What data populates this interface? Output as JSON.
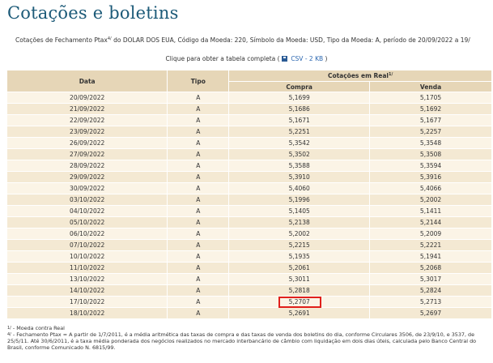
{
  "title": "Cotações e boletins",
  "description": {
    "prefix": "Cotações de Fechamento Ptax",
    "sup": "4/",
    "suffix": " do DOLAR DOS EUA, Código da Moeda: 220, Símbolo da Moeda: USD, Tipo da Moeda: A, período de 20/09/2022 a 19/"
  },
  "download": {
    "prefix": "Clique para obter a tabela completa ( ",
    "icon": "save-disk-icon",
    "link_label": "CSV - 2 KB",
    "suffix": " )"
  },
  "table": {
    "headers": {
      "data": "Data",
      "tipo": "Tipo",
      "cotacoes": "Cotações em Real",
      "cotacoes_sup": "1/",
      "compra": "Compra",
      "venda": "Venda"
    },
    "rows": [
      {
        "data": "20/09/2022",
        "tipo": "A",
        "compra": "5,1699",
        "venda": "5,1705"
      },
      {
        "data": "21/09/2022",
        "tipo": "A",
        "compra": "5,1686",
        "venda": "5,1692"
      },
      {
        "data": "22/09/2022",
        "tipo": "A",
        "compra": "5,1671",
        "venda": "5,1677"
      },
      {
        "data": "23/09/2022",
        "tipo": "A",
        "compra": "5,2251",
        "venda": "5,2257"
      },
      {
        "data": "26/09/2022",
        "tipo": "A",
        "compra": "5,3542",
        "venda": "5,3548"
      },
      {
        "data": "27/09/2022",
        "tipo": "A",
        "compra": "5,3502",
        "venda": "5,3508"
      },
      {
        "data": "28/09/2022",
        "tipo": "A",
        "compra": "5,3588",
        "venda": "5,3594"
      },
      {
        "data": "29/09/2022",
        "tipo": "A",
        "compra": "5,3910",
        "venda": "5,3916"
      },
      {
        "data": "30/09/2022",
        "tipo": "A",
        "compra": "5,4060",
        "venda": "5,4066"
      },
      {
        "data": "03/10/2022",
        "tipo": "A",
        "compra": "5,1996",
        "venda": "5,2002"
      },
      {
        "data": "04/10/2022",
        "tipo": "A",
        "compra": "5,1405",
        "venda": "5,1411"
      },
      {
        "data": "05/10/2022",
        "tipo": "A",
        "compra": "5,2138",
        "venda": "5,2144"
      },
      {
        "data": "06/10/2022",
        "tipo": "A",
        "compra": "5,2002",
        "venda": "5,2009"
      },
      {
        "data": "07/10/2022",
        "tipo": "A",
        "compra": "5,2215",
        "venda": "5,2221"
      },
      {
        "data": "10/10/2022",
        "tipo": "A",
        "compra": "5,1935",
        "venda": "5,1941"
      },
      {
        "data": "11/10/2022",
        "tipo": "A",
        "compra": "5,2061",
        "venda": "5,2068"
      },
      {
        "data": "13/10/2022",
        "tipo": "A",
        "compra": "5,3011",
        "venda": "5,3017"
      },
      {
        "data": "14/10/2022",
        "tipo": "A",
        "compra": "5,2818",
        "venda": "5,2824"
      },
      {
        "data": "17/10/2022",
        "tipo": "A",
        "compra": "5,2707",
        "venda": "5,2713"
      },
      {
        "data": "18/10/2022",
        "tipo": "A",
        "compra": "5,2691",
        "venda": "5,2697"
      }
    ],
    "highlight": {
      "row": 18,
      "column": "compra",
      "color": "#e0201b"
    }
  },
  "notes": [
    {
      "sup": "1/",
      "text": " - Moeda contra Real"
    },
    {
      "sup": "4/",
      "text": " - Fechamento Ptax = A partir de 1/7/2011, é a média aritmética das taxas de compra e das taxas de venda dos boletins do dia, conforme Circulares 3506, de 23/9/10, e 3537, de 25/5/11. Até 30/6/2011, é a taxa média ponderada dos negócios realizados no mercado interbancário de câmbio com liquidação em dois dias úteis, calculada pelo Banco Central do Brasil, conforme Comunicado N. 6815/99."
    }
  ],
  "colors": {
    "title": "#1c5a78",
    "header_bg": "#e6d6b7",
    "row_light": "#fbf4e6",
    "row_dark": "#f4e9d3",
    "link": "#2a66b0"
  }
}
